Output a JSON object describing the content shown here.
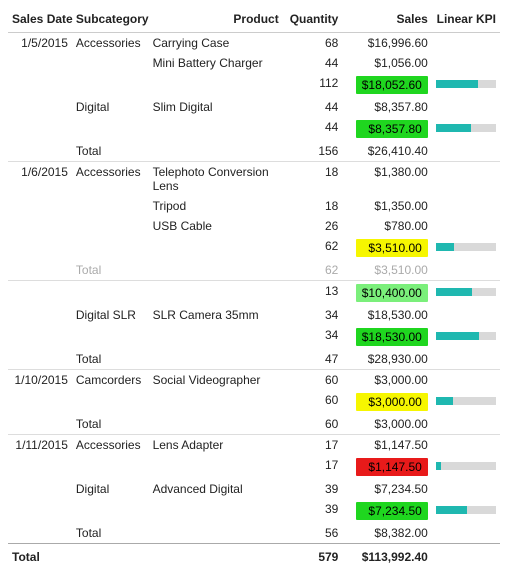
{
  "headers": {
    "date": "Sales Date",
    "subcategory": "Subcategory",
    "product": "Product",
    "quantity": "Quantity",
    "sales": "Sales",
    "kpi": "Linear KPI"
  },
  "labels": {
    "total": "Total"
  },
  "grand_total": {
    "quantity": "579",
    "sales": "$113,992.40"
  },
  "colors": {
    "green": "#1fd61f",
    "light_green": "#7bef7b",
    "yellow": "#f6f600",
    "red": "#e81a1a",
    "kpi_bar": "#1fb8b0",
    "kpi_track": "#d9d9d9"
  },
  "rows": [
    {
      "date": "1/5/2015",
      "sub": "Accessories",
      "prod": "Carrying Case",
      "qty": "68",
      "sales": "$16,996.60"
    },
    {
      "prod": "Mini Battery Charger",
      "qty": "44",
      "sales": "$1,056.00"
    },
    {
      "qty": "112",
      "sales": "$18,052.60",
      "bg": "green",
      "kpi": 70
    },
    {
      "sub": "Digital",
      "prod": "Slim Digital",
      "qty": "44",
      "sales": "$8,357.80"
    },
    {
      "qty": "44",
      "sales": "$8,357.80",
      "bg": "green",
      "kpi": 58
    },
    {
      "sub": "Total",
      "qty": "156",
      "sales": "$26,410.40",
      "divider_after": true
    },
    {
      "date": "1/6/2015",
      "sub": "Accessories",
      "prod": "Telephoto Conversion Lens",
      "qty": "18",
      "sales": "$1,380.00"
    },
    {
      "prod": "Tripod",
      "qty": "18",
      "sales": "$1,350.00"
    },
    {
      "prod": "USB Cable",
      "qty": "26",
      "sales": "$780.00"
    },
    {
      "qty": "62",
      "sales": "$3,510.00",
      "bg": "yellow",
      "kpi": 30
    },
    {
      "sub": "Total",
      "qty": "62",
      "sales": "$3,510.00",
      "faded": true,
      "divider_after": true
    },
    {
      "qty": "13",
      "sales": "$10,400.00",
      "bg": "lgreen",
      "kpi": 60
    },
    {
      "sub": "Digital SLR",
      "prod": "SLR Camera 35mm",
      "qty": "34",
      "sales": "$18,530.00"
    },
    {
      "qty": "34",
      "sales": "$18,530.00",
      "bg": "green",
      "kpi": 72
    },
    {
      "sub": "Total",
      "qty": "47",
      "sales": "$28,930.00",
      "divider_after": true
    },
    {
      "date": "1/10/2015",
      "sub": "Camcorders",
      "prod": "Social Videographer",
      "qty": "60",
      "sales": "$3,000.00"
    },
    {
      "qty": "60",
      "sales": "$3,000.00",
      "bg": "yellow",
      "kpi": 28
    },
    {
      "sub": "Total",
      "qty": "60",
      "sales": "$3,000.00",
      "divider_after": true
    },
    {
      "date": "1/11/2015",
      "sub": "Accessories",
      "prod": "Lens Adapter",
      "qty": "17",
      "sales": "$1,147.50"
    },
    {
      "qty": "17",
      "sales": "$1,147.50",
      "bg": "red",
      "kpi": 8
    },
    {
      "sub": "Digital",
      "prod": "Advanced Digital",
      "qty": "39",
      "sales": "$7,234.50"
    },
    {
      "qty": "39",
      "sales": "$7,234.50",
      "bg": "green",
      "kpi": 52
    },
    {
      "sub": "Total",
      "qty": "56",
      "sales": "$8,382.00"
    }
  ]
}
